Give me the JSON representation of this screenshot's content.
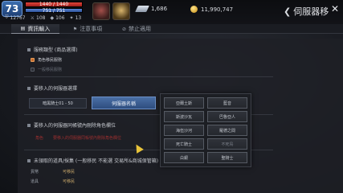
{
  "player": {
    "level": "73",
    "hp_text": "1440 / 1440",
    "hp_fraction": 1.0,
    "mp_text": "751 / 751",
    "mp_fraction": 1.0,
    "stats": [
      "12767",
      "108",
      "106",
      "13"
    ]
  },
  "currency": {
    "diamonds": "1,686",
    "gold": "11,990,747"
  },
  "window": {
    "title": "伺服器移",
    "close": "✕"
  },
  "tabs": [
    {
      "label": "資訊輸入",
      "active": true
    },
    {
      "label": "注意事項",
      "active": false
    },
    {
      "label": "禁止適用",
      "active": false
    }
  ],
  "form": {
    "section1_title": "服務類型 (商品選擇)",
    "option1": "角色移民服務",
    "option2": "一般移民服務",
    "section2_title": "要移入的伺服器選擇",
    "btn_left": "暗黑騎士01 - 50",
    "btn_right": "伺服器名稱",
    "section3_title": "要移入的伺服器同帳號內刪除角色欄位",
    "warning_label": "角色",
    "warning_text": "要移入的伺服器同帳號內刪除角色欄位",
    "section4_title": "未領取的道具/採集 (一般移民 不能選 交易所&商城保管箱)",
    "row1_label": "貨幣",
    "row1_value": "可移民",
    "row2_label": "道具",
    "row2_value": "可移民"
  },
  "servers": [
    {
      "label": "亞爾土斯",
      "dim": false
    },
    {
      "label": "藍音",
      "dim": false
    },
    {
      "label": "斯波沙瓦",
      "dim": false
    },
    {
      "label": "巴魯亞人",
      "dim": false
    },
    {
      "label": "海伍沙河",
      "dim": false
    },
    {
      "label": "羅德之間",
      "dim": false
    },
    {
      "label": "死亡騎士",
      "dim": false
    },
    {
      "label": "不死鳥",
      "dim": true
    },
    {
      "label": "白銀",
      "dim": false
    },
    {
      "label": "聖騎士",
      "dim": false
    }
  ],
  "colors": {
    "accent_blue": "#4a6fa5",
    "hp_red": "#e0453b",
    "warning_red": "#9b2f2f",
    "gold": "#c9a86a"
  }
}
